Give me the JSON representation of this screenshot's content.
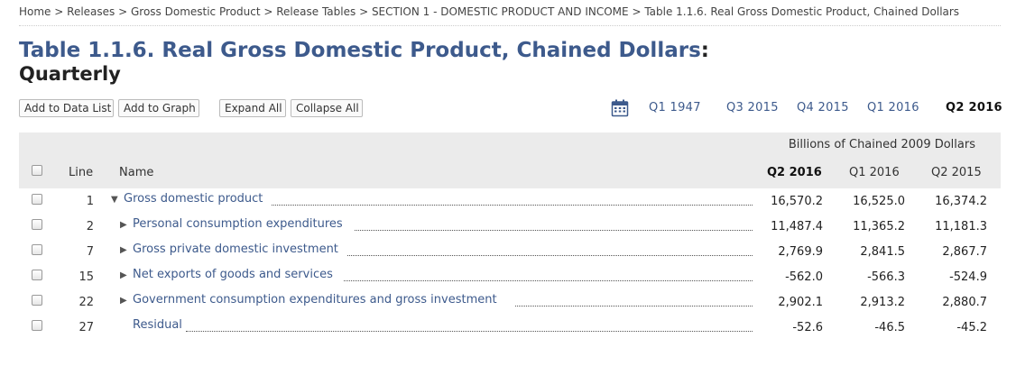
{
  "breadcrumb": [
    "Home",
    "Releases",
    "Gross Domestic Product",
    "Release Tables",
    "SECTION 1 - DOMESTIC PRODUCT AND INCOME",
    "Table 1.1.6. Real Gross Domestic Product, Chained Dollars"
  ],
  "breadcrumb_separator": ">",
  "title": "Table 1.1.6. Real Gross Domestic Product, Chained Dollars",
  "title_colon": ":",
  "subtitle": "Quarterly",
  "buttons": {
    "add_to_data_list": "Add to Data List",
    "add_to_graph": "Add to Graph",
    "expand_all": "Expand All",
    "collapse_all": "Collapse All"
  },
  "calendar_icon": "calendar-icon",
  "quarters": [
    "Q1 1947",
    "Q3 2015",
    "Q4 2015",
    "Q1 2016",
    "Q2 2016"
  ],
  "active_quarter": "Q2 2016",
  "table": {
    "units": "Billions of Chained 2009 Dollars",
    "headers": {
      "line": "Line",
      "name": "Name",
      "cols": [
        "Q2 2016",
        "Q1 2016",
        "Q2 2015"
      ]
    },
    "rows": [
      {
        "line": "1",
        "name": "Gross domestic product",
        "expander": "expanded",
        "values": [
          "16,570.2",
          "16,525.0",
          "16,374.2"
        ]
      },
      {
        "line": "2",
        "name": "Personal consumption expenditures",
        "expander": "collapsed",
        "values": [
          "11,487.4",
          "11,365.2",
          "11,181.3"
        ]
      },
      {
        "line": "7",
        "name": "Gross private domestic investment",
        "expander": "collapsed",
        "values": [
          "2,769.9",
          "2,841.5",
          "2,867.7"
        ]
      },
      {
        "line": "15",
        "name": "Net exports of goods and services",
        "expander": "collapsed",
        "values": [
          "-562.0",
          "-566.3",
          "-524.9"
        ]
      },
      {
        "line": "22",
        "name": "Government consumption expenditures and gross investment",
        "expander": "collapsed",
        "values": [
          "2,902.1",
          "2,913.2",
          "2,880.7"
        ]
      },
      {
        "line": "27",
        "name": "Residual",
        "expander": "none",
        "values": [
          "-52.6",
          "-46.5",
          "-45.2"
        ]
      }
    ]
  },
  "colors": {
    "link": "#3d5a8c",
    "header_bg": "#ebebeb"
  }
}
